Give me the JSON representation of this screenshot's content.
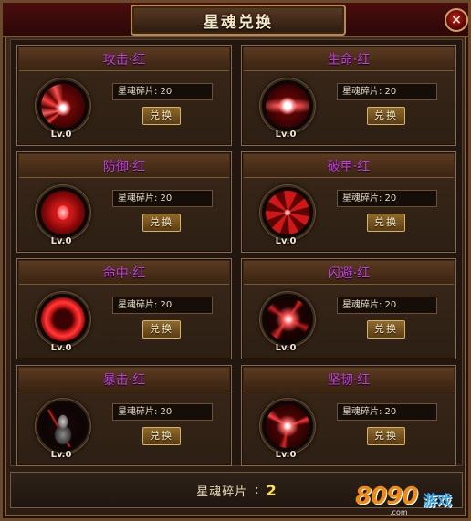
{
  "window": {
    "title": "星魂兑换",
    "close_label": "×"
  },
  "cards": [
    {
      "name": "攻击·红",
      "shards": "星魂碎片: 20",
      "button": "兑换",
      "level": "Lv.0",
      "icon": "winged-flame-orb-icon"
    },
    {
      "name": "生命·红",
      "shards": "星魂碎片: 20",
      "button": "兑换",
      "level": "Lv.0",
      "icon": "winged-heart-orb-icon"
    },
    {
      "name": "防御·红",
      "shards": "星魂碎片: 20",
      "button": "兑换",
      "level": "Lv.0",
      "icon": "shield-orb-icon"
    },
    {
      "name": "破甲·红",
      "shards": "星魂碎片: 20",
      "button": "兑换",
      "level": "Lv.0",
      "icon": "vortex-orb-icon"
    },
    {
      "name": "命中·红",
      "shards": "星魂碎片: 20",
      "button": "兑换",
      "level": "Lv.0",
      "icon": "ring-orb-icon"
    },
    {
      "name": "闪避·红",
      "shards": "星魂碎片: 20",
      "button": "兑换",
      "level": "Lv.0",
      "icon": "burst-orb-icon"
    },
    {
      "name": "暴击·红",
      "shards": "星魂碎片: 20",
      "button": "兑换",
      "level": "Lv.0",
      "icon": "armored-warrior-orb-icon"
    },
    {
      "name": "坚韧·红",
      "shards": "星魂碎片: 20",
      "button": "兑换",
      "level": "Lv.0",
      "icon": "spark-orb-icon"
    }
  ],
  "footer": {
    "label": "星魂碎片",
    "colon": ":",
    "count": "2"
  },
  "watermark": {
    "digits": "8090",
    "text": "游戏",
    "suffix": ".com"
  },
  "colors": {
    "card_title": "#c43ce6",
    "count": "#ffe04d",
    "accent_red": "#c0101a"
  }
}
